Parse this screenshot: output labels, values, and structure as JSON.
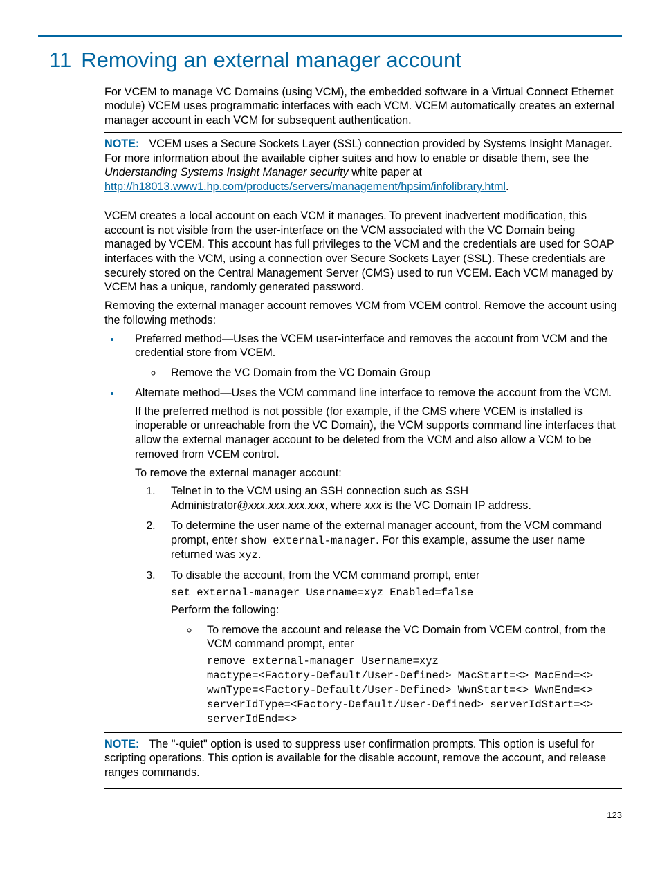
{
  "chapter_number": "11",
  "chapter_title": "Removing an external manager account",
  "para_intro": "For VCEM to manage VC Domains (using VCM), the embedded software in a Virtual Connect Ethernet module) VCEM uses programmatic interfaces with each VCM. VCEM automatically creates an external manager account in each VCM for subsequent authentication.",
  "note1_label": "NOTE:",
  "note1_text_a": "VCEM uses a Secure Sockets Layer (SSL) connection provided by Systems Insight Manager. For more information about the available cipher suites and how to enable or disable them, see the ",
  "note1_italic": "Understanding Systems Insight Manager security",
  "note1_text_b": " white paper at ",
  "note1_link": "http://h18013.www1.hp.com/products/servers/management/hpsim/infolibrary.html",
  "note1_text_c": ".",
  "para_local": "VCEM creates a local account on each VCM it manages. To prevent inadvertent modification, this account is not visible from the user-interface on the VCM associated with the VC Domain being managed by VCEM. This account has full privileges to the VCM and the credentials are used for SOAP interfaces with the VCM, using a connection over Secure Sockets Layer (SSL). These credentials are securely stored on the Central Management Server (CMS) used to run VCEM. Each VCM managed by VCEM has a unique, randomly generated password.",
  "para_remove_intro": "Removing the external manager account removes VCM from VCEM control. Remove the account using the following methods:",
  "bullet_pref": "Preferred method—Uses the VCEM user-interface and removes the account from VCM and the credential store from VCEM.",
  "bullet_pref_sub": "Remove the VC Domain from the VC Domain Group",
  "bullet_alt": "Alternate method—Uses the VCM command line interface to remove the account from the VCM.",
  "bullet_alt_p1": "If the preferred method is not possible (for example, if the CMS where VCEM is installed is inoperable or unreachable from the VC Domain), the VCM supports command line interfaces that allow the external manager account to be deleted from the VCM and also allow a VCM to be removed from VCEM control.",
  "bullet_alt_p2": "To remove the external manager account:",
  "step1_a": "Telnet in to the VCM using an SSH connection such as SSH Administrator@",
  "step1_i": "xxx.xxx.xxx.xxx",
  "step1_b": ", where ",
  "step1_i2": "xxx",
  "step1_c": " is the VC Domain IP address.",
  "step2_a": "To determine the user name of the external manager account, from the VCM command prompt, enter ",
  "step2_code1": "show external-manager",
  "step2_b": ". For this example, assume the user name returned was ",
  "step2_code2": "xyz",
  "step2_c": ".",
  "step3_a": "To disable the account, from the VCM command prompt, enter",
  "step3_code": "set external-manager Username=xyz Enabled=false",
  "step3_b": "Perform the following:",
  "step3_sub_a": "To remove the account and release the VC Domain from VCEM control, from the VCM command prompt, enter",
  "step3_sub_code": "remove external-manager Username=xyz\nmactype=<Factory-Default/User-Defined> MacStart=<> MacEnd=<> wwnType=<Factory-Default/User-Defined> WwnStart=<> WwnEnd=<> serverIdType=<Factory-Default/User-Defined> serverIdStart=<> serverIdEnd=<>",
  "note2_label": "NOTE:",
  "note2_text": "The \"-quiet\" option is used to suppress user confirmation prompts. This option is useful for scripting operations. This option is available for the disable account, remove the account, and release ranges commands.",
  "page_number": "123"
}
